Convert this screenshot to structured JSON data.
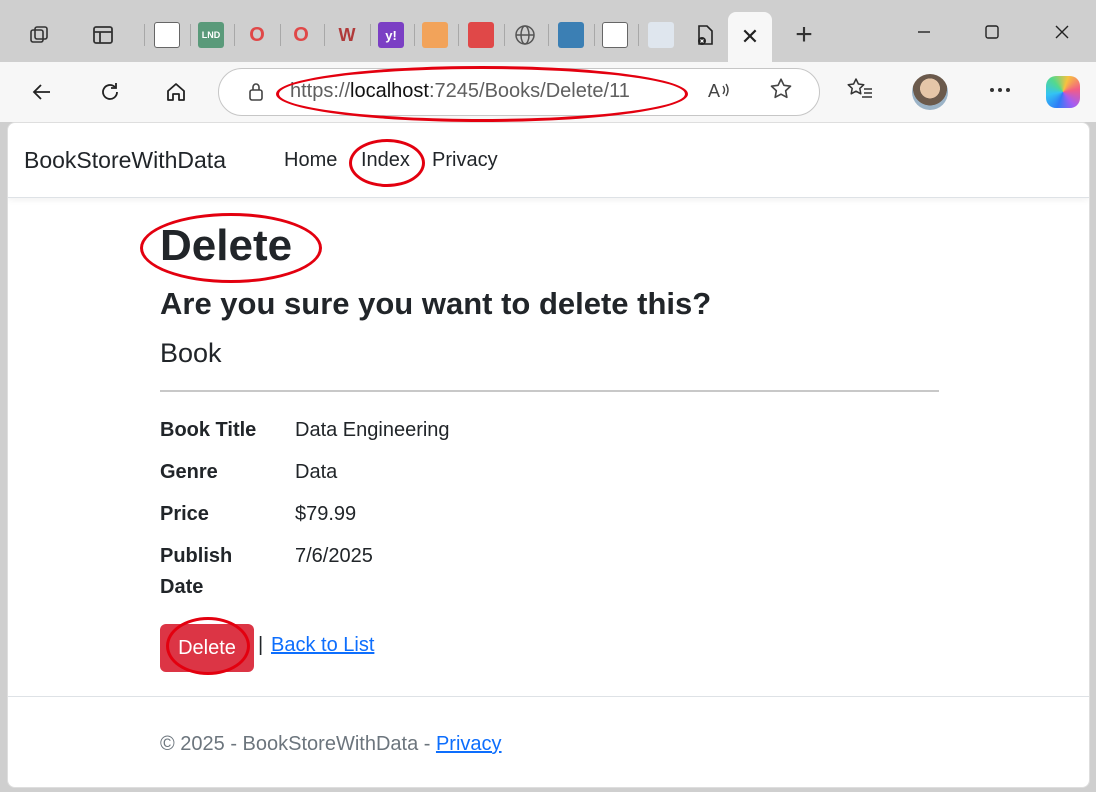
{
  "browser": {
    "url_prefix": "https://",
    "url_host": "localhost",
    "url_rest": ":7245/Books/Delete/11",
    "close_tab_glyph": "✕",
    "new_tab_glyph": "+",
    "icons": [
      "tab-actions-icon",
      "vertical-tabs-icon",
      "back-icon",
      "refresh-icon",
      "home-icon",
      "lock-icon",
      "read-aloud-icon",
      "favorite-star-icon",
      "favorites-icon",
      "more-icon",
      "copilot-icon"
    ]
  },
  "navbar": {
    "brand": "BookStoreWithData",
    "links": [
      "Home",
      "Index",
      "Privacy"
    ]
  },
  "main": {
    "title": "Delete",
    "question": "Are you sure you want to delete this?",
    "entity": "Book",
    "fields": [
      {
        "label": "Book Title",
        "value": "Data Engineering"
      },
      {
        "label": "Genre",
        "value": "Data"
      },
      {
        "label": "Price",
        "value": "$79.99"
      },
      {
        "label_line1": "Publish",
        "label_line2": "Date",
        "value": "7/6/2025"
      }
    ],
    "delete_button": "Delete",
    "separator": "|",
    "back_link": "Back to List"
  },
  "footer": {
    "text": "© 2025 - BookStoreWithData - ",
    "link": "Privacy"
  },
  "colors": {
    "danger": "#dc3545",
    "link": "#0d6efd",
    "annotation": "#e3000f"
  }
}
